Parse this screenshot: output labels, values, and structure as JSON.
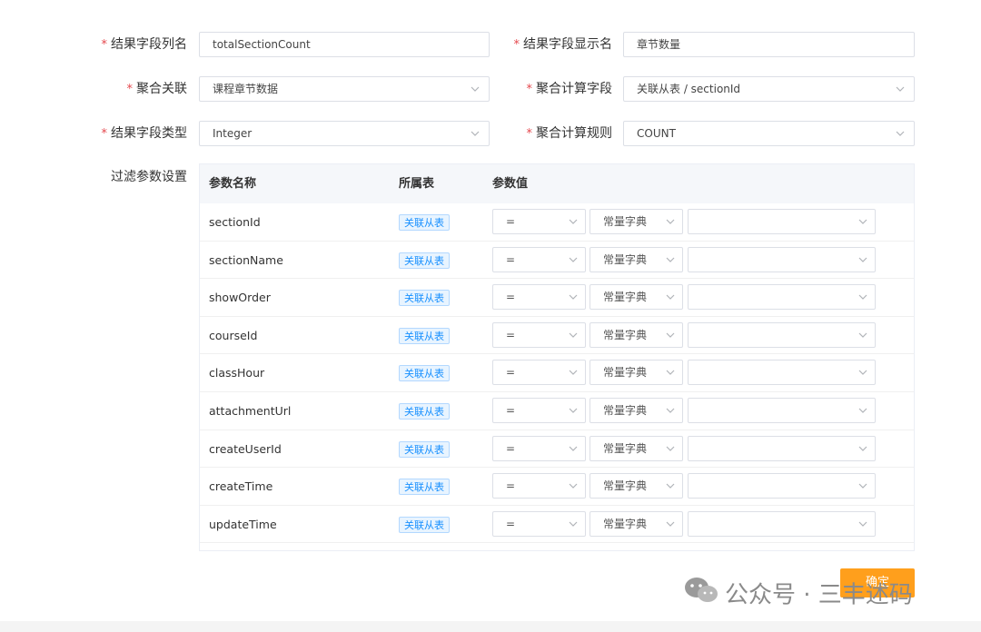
{
  "form": {
    "result_field_column": {
      "label": "结果字段列名",
      "value": "totalSectionCount"
    },
    "result_field_display": {
      "label": "结果字段显示名",
      "value": "章节数量"
    },
    "aggregate_relation": {
      "label": "聚合关联",
      "value": "课程章节数据"
    },
    "aggregate_field": {
      "label": "聚合计算字段",
      "value": "关联从表 / sectionId"
    },
    "result_field_type": {
      "label": "结果字段类型",
      "value": "Integer"
    },
    "aggregate_rule": {
      "label": "聚合计算规则",
      "value": "COUNT"
    },
    "filter_label": "过滤参数设置"
  },
  "table": {
    "headers": {
      "param_name": "参数名称",
      "table": "所属表",
      "param_value": "参数值"
    },
    "rows": [
      {
        "name": "sectionId",
        "table": "关联从表",
        "op": "=",
        "source": "常量字典",
        "value": ""
      },
      {
        "name": "sectionName",
        "table": "关联从表",
        "op": "=",
        "source": "常量字典",
        "value": ""
      },
      {
        "name": "showOrder",
        "table": "关联从表",
        "op": "=",
        "source": "常量字典",
        "value": ""
      },
      {
        "name": "courseId",
        "table": "关联从表",
        "op": "=",
        "source": "常量字典",
        "value": ""
      },
      {
        "name": "classHour",
        "table": "关联从表",
        "op": "=",
        "source": "常量字典",
        "value": ""
      },
      {
        "name": "attachmentUrl",
        "table": "关联从表",
        "op": "=",
        "source": "常量字典",
        "value": ""
      },
      {
        "name": "createUserId",
        "table": "关联从表",
        "op": "=",
        "source": "常量字典",
        "value": ""
      },
      {
        "name": "createTime",
        "table": "关联从表",
        "op": "=",
        "source": "常量字典",
        "value": ""
      },
      {
        "name": "updateTime",
        "table": "关联从表",
        "op": "=",
        "source": "常量字典",
        "value": ""
      }
    ]
  },
  "buttons": {
    "confirm": "确定"
  },
  "watermark": "公众号 · 三丰述码",
  "colors": {
    "accent": "#ff9f1c",
    "tag_blue": "#1890ff",
    "required": "#e5484d"
  }
}
